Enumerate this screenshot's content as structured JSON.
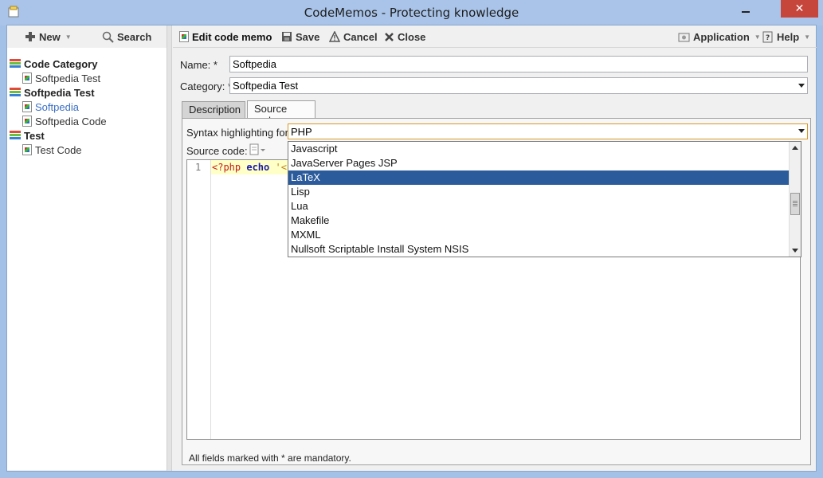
{
  "window": {
    "title": "CodeMemos - Protecting knowledge",
    "close_glyph": "✕"
  },
  "left_toolbar": {
    "new_label": "New",
    "search_label": "Search"
  },
  "tree": [
    {
      "label": "Code Category",
      "level": 0,
      "icon": "category-icon"
    },
    {
      "label": "Softpedia Test",
      "level": 1,
      "icon": "memo-icon"
    },
    {
      "label": "Softpedia Test",
      "level": 0,
      "icon": "category-icon"
    },
    {
      "label": "Softpedia",
      "level": 1,
      "icon": "memo-icon",
      "selected": true
    },
    {
      "label": "Softpedia Code",
      "level": 1,
      "icon": "memo-icon"
    },
    {
      "label": "Test",
      "level": 0,
      "icon": "category-icon"
    },
    {
      "label": "Test Code",
      "level": 1,
      "icon": "memo-icon"
    }
  ],
  "right_toolbar": {
    "edit_label": "Edit code memo",
    "save_label": "Save",
    "cancel_label": "Cancel",
    "close_label": "Close",
    "application_label": "Application",
    "help_label": "Help"
  },
  "form": {
    "name_label": "Name: *",
    "name_value": "Softpedia",
    "category_label": "Category: *",
    "category_value": "Softpedia Test"
  },
  "tabs": [
    {
      "label": "Description",
      "active": false
    },
    {
      "label": "Source code",
      "active": true
    }
  ],
  "source": {
    "syntax_label": "Syntax highlighting for:",
    "syntax_value": "PHP",
    "source_code_label": "Source code:",
    "line_number": "1",
    "code_open_tag": "<?php",
    "code_keyword": "echo",
    "code_string": "'<p"
  },
  "dropdown_options": [
    "Javascript",
    "JavaServer Pages JSP",
    "LaTeX",
    "Lisp",
    "Lua",
    "Makefile",
    "MXML",
    "Nullsoft Scriptable Install System NSIS"
  ],
  "dropdown_highlighted": "LaTeX",
  "footer": {
    "note": "All fields marked with * are mandatory."
  },
  "colors": {
    "selection": "#2c5b9c",
    "tree_selected_text": "#3a6fc4",
    "close_button": "#c7463b"
  }
}
